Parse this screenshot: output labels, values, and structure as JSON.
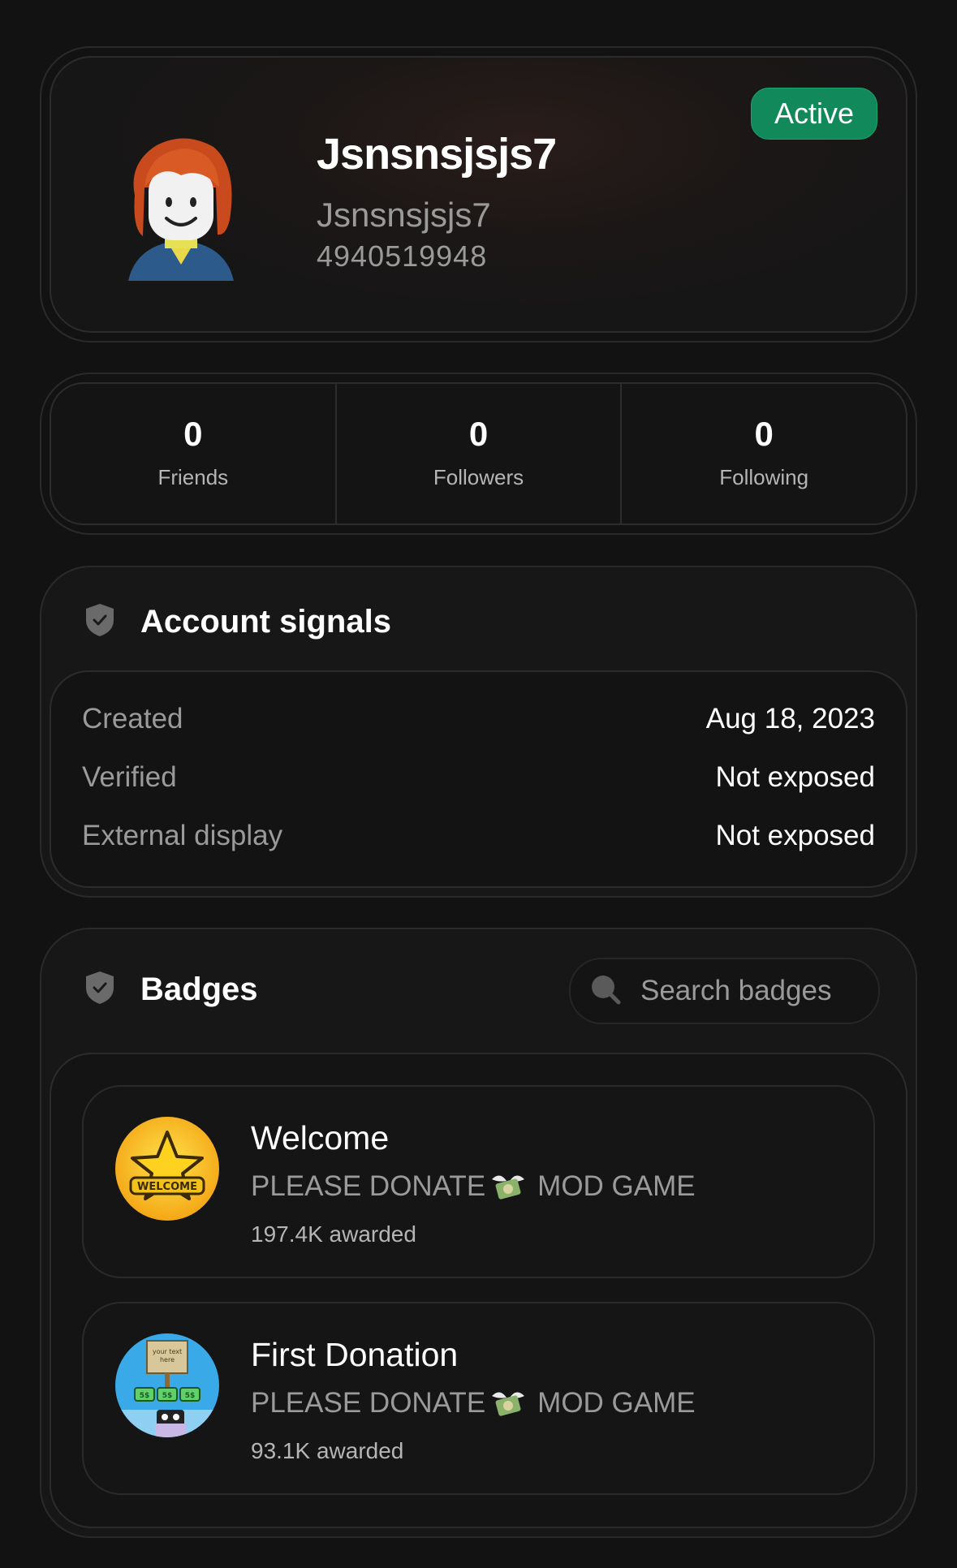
{
  "profile": {
    "username": "Jsnsnsjsjs7",
    "display_name": "Jsnsnsjsjs7",
    "user_id": "4940519948",
    "status": "Active",
    "status_color": "#11895a"
  },
  "stats": [
    {
      "value": "0",
      "label": "Friends"
    },
    {
      "value": "0",
      "label": "Followers"
    },
    {
      "value": "0",
      "label": "Following"
    }
  ],
  "signals": {
    "title": "Account signals",
    "rows": [
      {
        "label": "Created",
        "value": "Aug 18, 2023"
      },
      {
        "label": "Verified",
        "value": "Not exposed"
      },
      {
        "label": "External display",
        "value": "Not exposed"
      }
    ]
  },
  "badges": {
    "title": "Badges",
    "search_placeholder": "Search badges",
    "items": [
      {
        "name": "Welcome",
        "game_prefix": "PLEASE DONATE",
        "game_suffix": "MOD GAME",
        "awarded": "197.4K awarded",
        "icon": "welcome-star-icon"
      },
      {
        "name": "First Donation",
        "game_prefix": "PLEASE DONATE",
        "game_suffix": "MOD GAME",
        "awarded": "93.1K awarded",
        "icon": "donation-sign-icon"
      }
    ],
    "icon_text": {
      "welcome": "WELCOME",
      "sign_line1": "your text",
      "sign_line2": "here",
      "sign_money": "5$"
    }
  }
}
